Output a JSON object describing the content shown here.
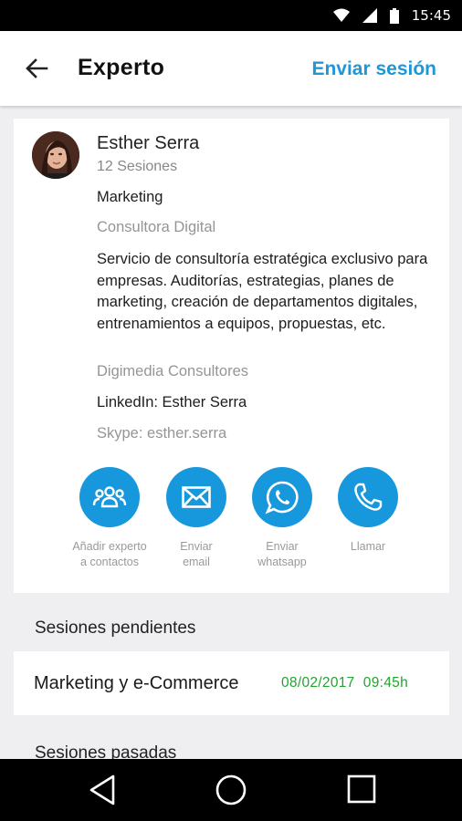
{
  "status_bar": {
    "time": "15:45"
  },
  "app_bar": {
    "title": "Experto",
    "action_label": "Enviar sesión"
  },
  "expert": {
    "name": "Esther Serra",
    "sessions": "12 Sesiones",
    "category": "Marketing",
    "role": "Consultora Digital",
    "description": "Servicio de consultoría estratégica exclusivo para empresas. Auditorías, estrategias, planes de marketing, creación de departamentos digitales, entrenamientos a equipos, propuestas, etc.",
    "company": "Digimedia Consultores",
    "linkedin": "LinkedIn: Esther Serra",
    "skype": "Skype: esther.serra"
  },
  "actions": [
    {
      "icon": "group-icon",
      "label_1": "Añadir experto",
      "label_2": "a contactos"
    },
    {
      "icon": "mail-icon",
      "label_1": "Enviar",
      "label_2": "email"
    },
    {
      "icon": "whatsapp-icon",
      "label_1": "Enviar",
      "label_2": "whatsapp"
    },
    {
      "icon": "phone-icon",
      "label_1": "Llamar",
      "label_2": ""
    }
  ],
  "pending_sessions": {
    "title": "Sesiones pendientes",
    "items": [
      {
        "name": "Marketing y e-Commerce",
        "datetime": "08/02/2017  09:45h"
      }
    ]
  },
  "past_sessions": {
    "title": "Sesiones pasadas"
  },
  "colors": {
    "accent": "#1798dd",
    "date_green": "#21a52e"
  }
}
